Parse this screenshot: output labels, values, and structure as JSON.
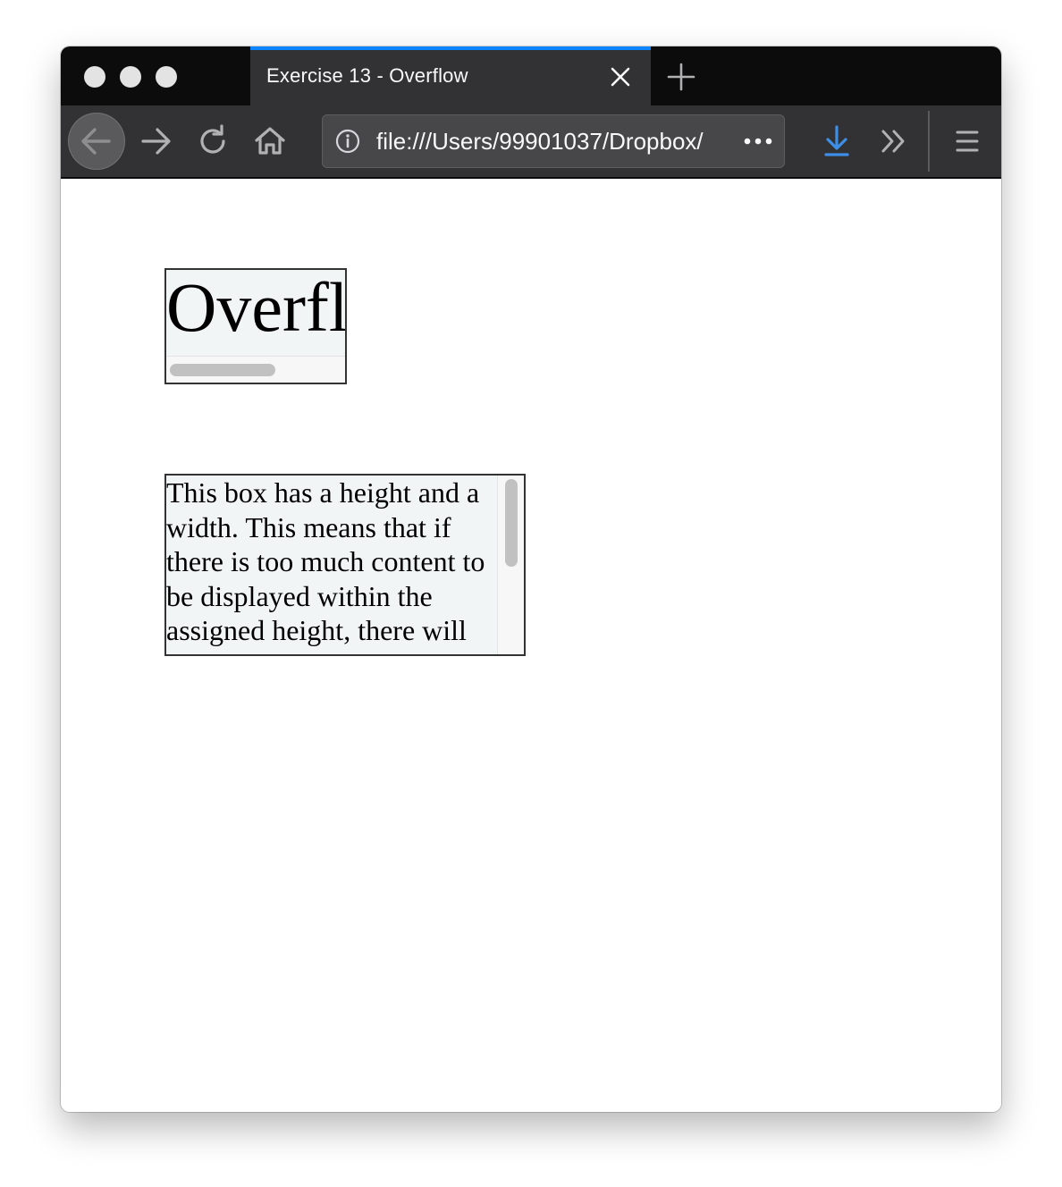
{
  "window": {
    "tab_title": "Exercise 13 - Overflow",
    "url": "file:///Users/99901037/Dropbox/",
    "accent_color": "#0a84ff",
    "toolbar_icons": [
      "back-icon",
      "forward-icon",
      "reload-icon",
      "home-icon",
      "info-icon",
      "more-icon",
      "download-icon",
      "overflow-icon",
      "menu-icon"
    ]
  },
  "page": {
    "box1_text": "Overflow",
    "box2_text": "This box has a height and a width. This means that if there is too much content to be displayed within the assigned height, there will be an overflow situation. If overflow is set to scroll, the user can scroll to see the rest of the content."
  }
}
